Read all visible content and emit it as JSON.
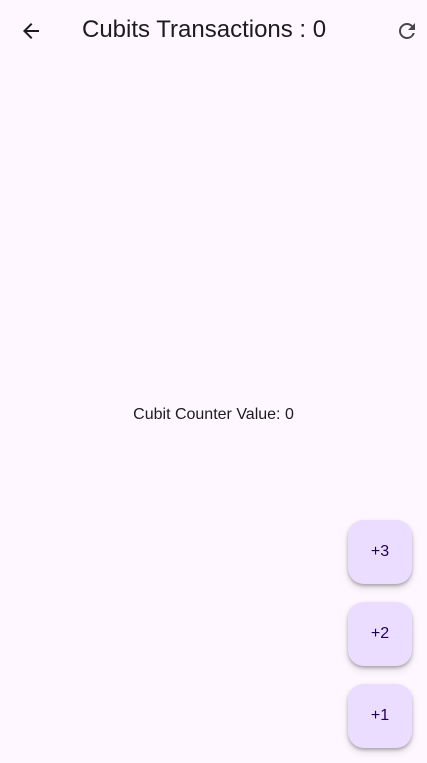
{
  "app_bar": {
    "title": "Cubits Transactions : 0",
    "back_icon": "arrow-back-icon",
    "refresh_icon": "refresh-icon"
  },
  "body": {
    "counter_text": "Cubit Counter Value: 0"
  },
  "fabs": [
    {
      "label": "+3"
    },
    {
      "label": "+2"
    },
    {
      "label": "+1"
    }
  ],
  "colors": {
    "background": "#fef7ff",
    "fab_background": "#eaddff",
    "text": "#1d1b20"
  }
}
